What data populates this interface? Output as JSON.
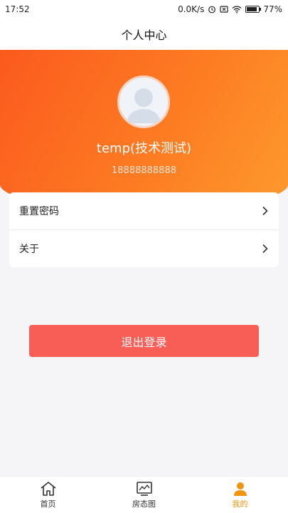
{
  "status": {
    "time": "17:52",
    "speed": "0.0K/s",
    "battery": "77%",
    "battery_level": 0.77
  },
  "nav": {
    "title": "个人中心"
  },
  "profile": {
    "name": "temp(技术测试)",
    "phone": "18888888888"
  },
  "menu": {
    "items": [
      {
        "label": "重置密码"
      },
      {
        "label": "关于"
      }
    ]
  },
  "actions": {
    "logout": "退出登录"
  },
  "tabs": [
    {
      "label": "首页",
      "icon": "home-icon"
    },
    {
      "label": "房态图",
      "icon": "chart-icon"
    },
    {
      "label": "我的",
      "icon": "user-icon",
      "active": true
    }
  ],
  "colors": {
    "accent": "#fd7b22",
    "logout": "#f95e56",
    "tab_active": "#f0940d"
  }
}
